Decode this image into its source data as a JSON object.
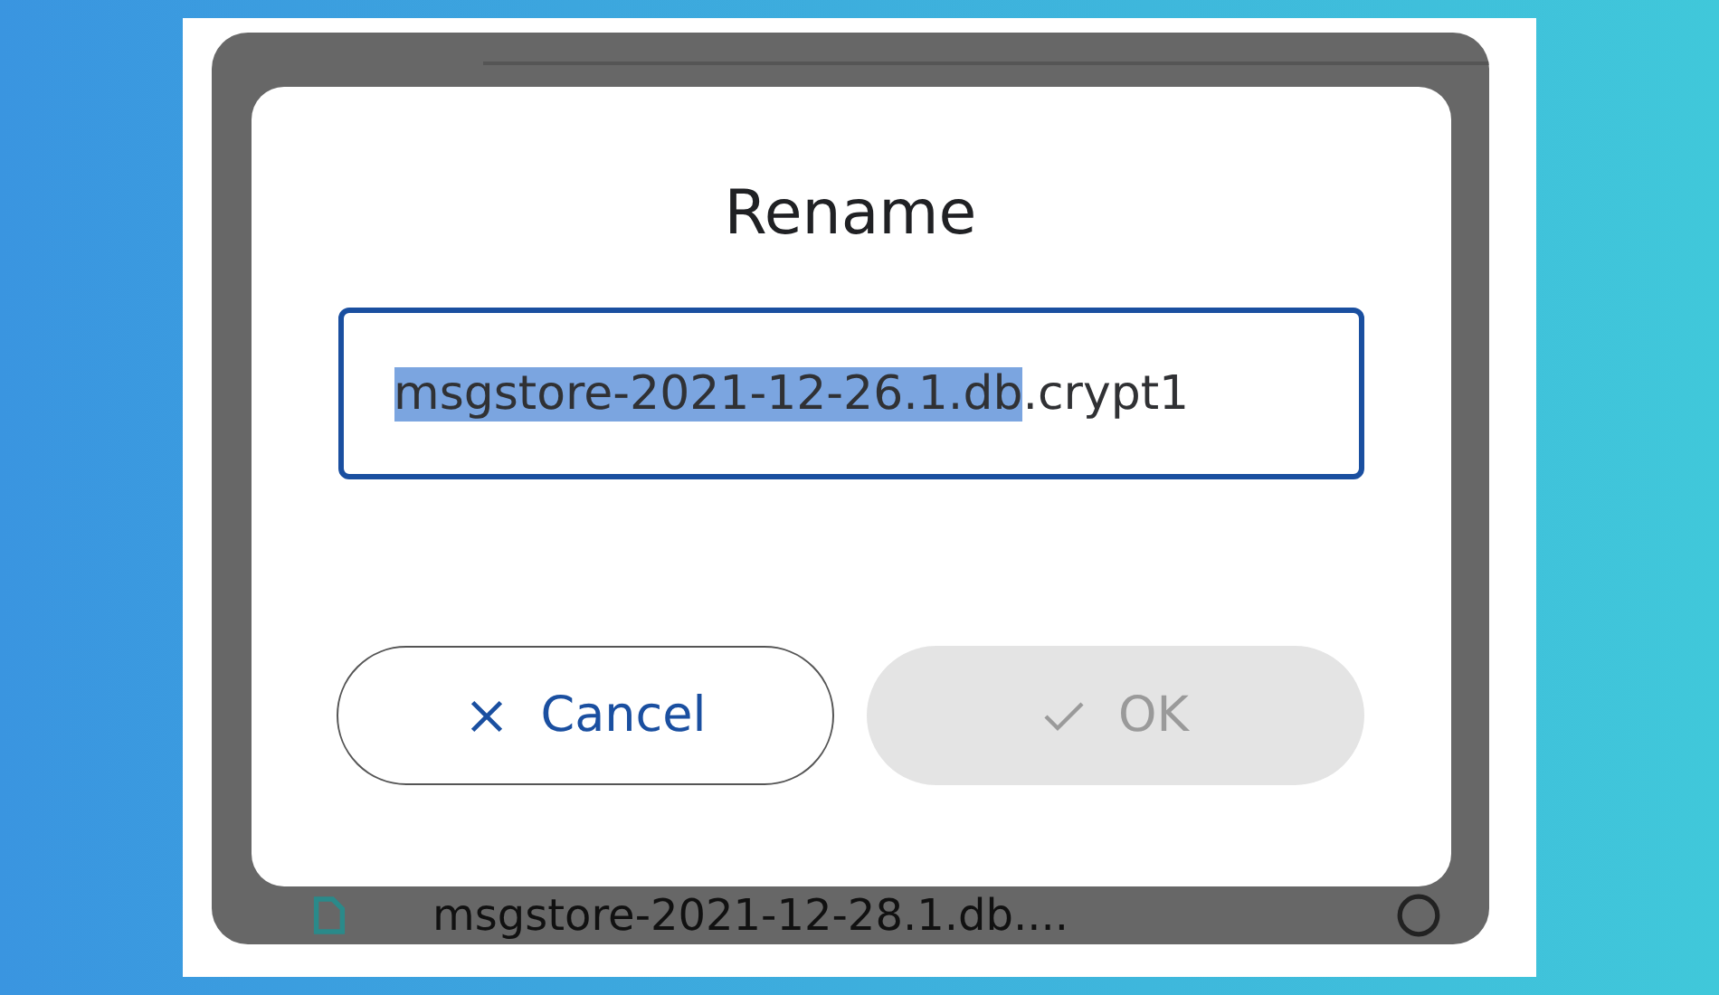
{
  "dialog": {
    "title": "Rename",
    "field": {
      "selected_text": "msgstore-2021-12-26.1.db",
      "rest_text": ".crypt1"
    },
    "buttons": [
      {
        "kind": "cancel",
        "label": "Cancel",
        "disabled": false
      },
      {
        "kind": "ok",
        "label": "OK",
        "disabled": true
      }
    ]
  },
  "background_file": {
    "name": "msgstore-2021-12-28.1.db...."
  }
}
